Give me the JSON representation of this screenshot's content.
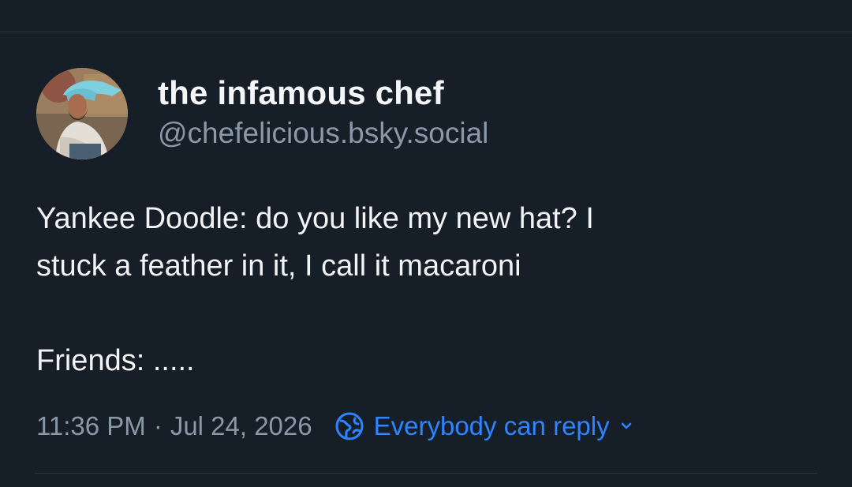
{
  "author": {
    "display_name": "the infamous chef",
    "handle": "@chefelicious.bsky.social",
    "avatar_icon": "avatar-image"
  },
  "post": {
    "lines": [
      "Yankee Doodle: do you like my new hat? I",
      "stuck a feather in it, I call it macaroni",
      "",
      "Friends: ....."
    ],
    "time": "11:36 PM",
    "separator": "·",
    "date": "Jul 24, 2026",
    "reply_setting": {
      "label": "Everybody can reply",
      "icon": "globe-icon",
      "chevron_icon": "chevron-down-icon",
      "color": "#2f84ff"
    }
  },
  "colors": {
    "background": "#161e27",
    "text": "#f1f3f5",
    "muted": "#8a98a8",
    "accent": "#2f84ff",
    "divider": "#2a3441"
  }
}
